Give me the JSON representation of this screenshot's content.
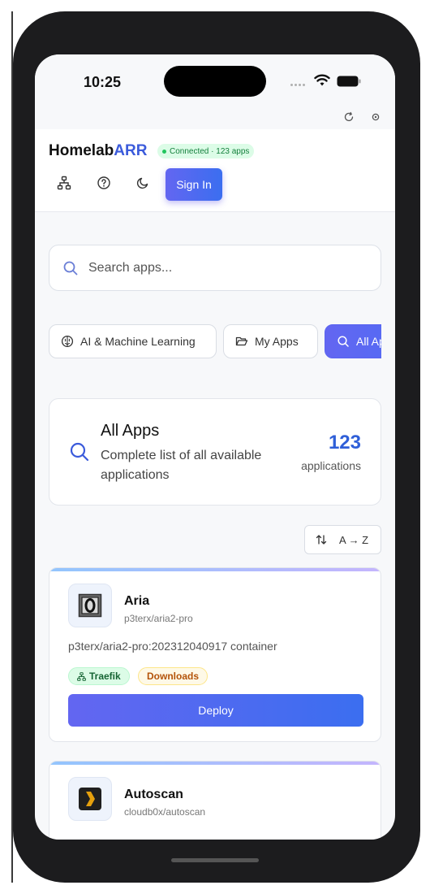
{
  "status_bar": {
    "time": "10:25"
  },
  "header": {
    "brand_prefix": "Homelab",
    "brand_accent": "ARR",
    "connection_status": "Connected · 123 apps",
    "sign_in_label": "Sign In"
  },
  "search": {
    "placeholder": "Search apps..."
  },
  "categories": [
    {
      "label": "AI & Machine Learning",
      "icon": "brain-icon",
      "active": false
    },
    {
      "label": "My Apps",
      "icon": "folder-icon",
      "active": false
    },
    {
      "label": "All Apps",
      "icon": "search-icon",
      "active": true
    }
  ],
  "summary": {
    "title": "All Apps",
    "description": "Complete list of all available applications",
    "count": "123",
    "count_label": "applications"
  },
  "sort": {
    "label": "A → Z"
  },
  "apps": [
    {
      "name": "Aria",
      "image": "p3terx/aria2-pro",
      "description": "p3terx/aria2-pro:202312040917 container",
      "tags": [
        "Traefik",
        "Downloads"
      ],
      "deploy_label": "Deploy"
    },
    {
      "name": "Autoscan",
      "image": "cloudb0x/autoscan"
    }
  ],
  "colors": {
    "accent": "#3b5bdb",
    "primary_gradient_start": "#6366f1",
    "primary_gradient_end": "#3b6ef0",
    "connected_green": "#22c55e"
  }
}
